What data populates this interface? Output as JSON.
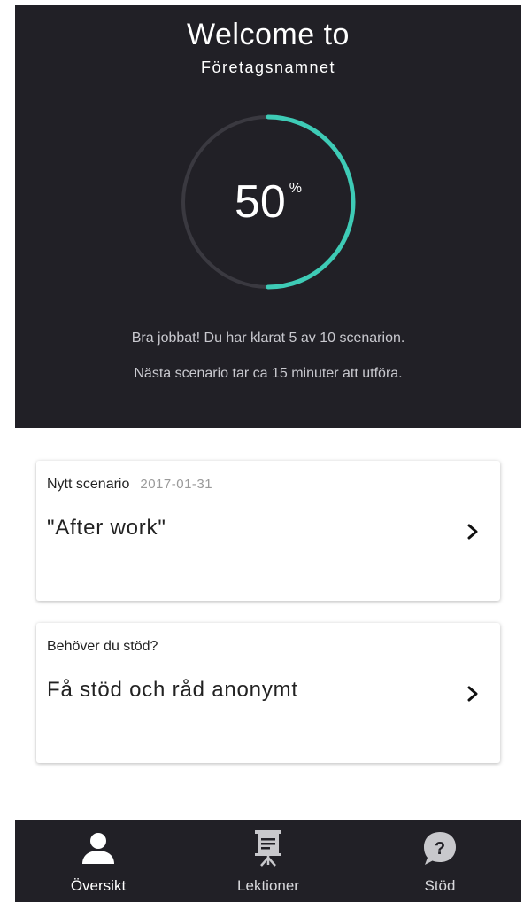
{
  "hero": {
    "title": "Welcome to",
    "subtitle": "Företagsnamnet",
    "progress": {
      "value": "50",
      "unit": "%",
      "fraction": 0.5,
      "track_color": "#3a3940",
      "fill_color": "#3ecbb6"
    },
    "message_line1": "Bra jobbat! Du har klarat 5 av 10 scenarion.",
    "message_line2": "Nästa scenario tar ca 15 minuter att utföra."
  },
  "cards": [
    {
      "kicker": "Nytt scenario",
      "date": "2017-01-31",
      "title": "\"After work\"",
      "icon": "chevron-right-icon"
    },
    {
      "kicker": "Behöver du stöd?",
      "title": "Få stöd och råd anonymt",
      "icon": "chevron-right-icon"
    }
  ],
  "tabbar": {
    "tabs": [
      {
        "label": "Översikt",
        "icon": "person-icon",
        "active": true
      },
      {
        "label": "Lektioner",
        "icon": "presentation-board-icon",
        "active": false
      },
      {
        "label": "Stöd",
        "icon": "question-bubble-icon",
        "active": false
      }
    ]
  },
  "colors": {
    "dark_background": "#212026",
    "accent": "#3ecbb6"
  }
}
